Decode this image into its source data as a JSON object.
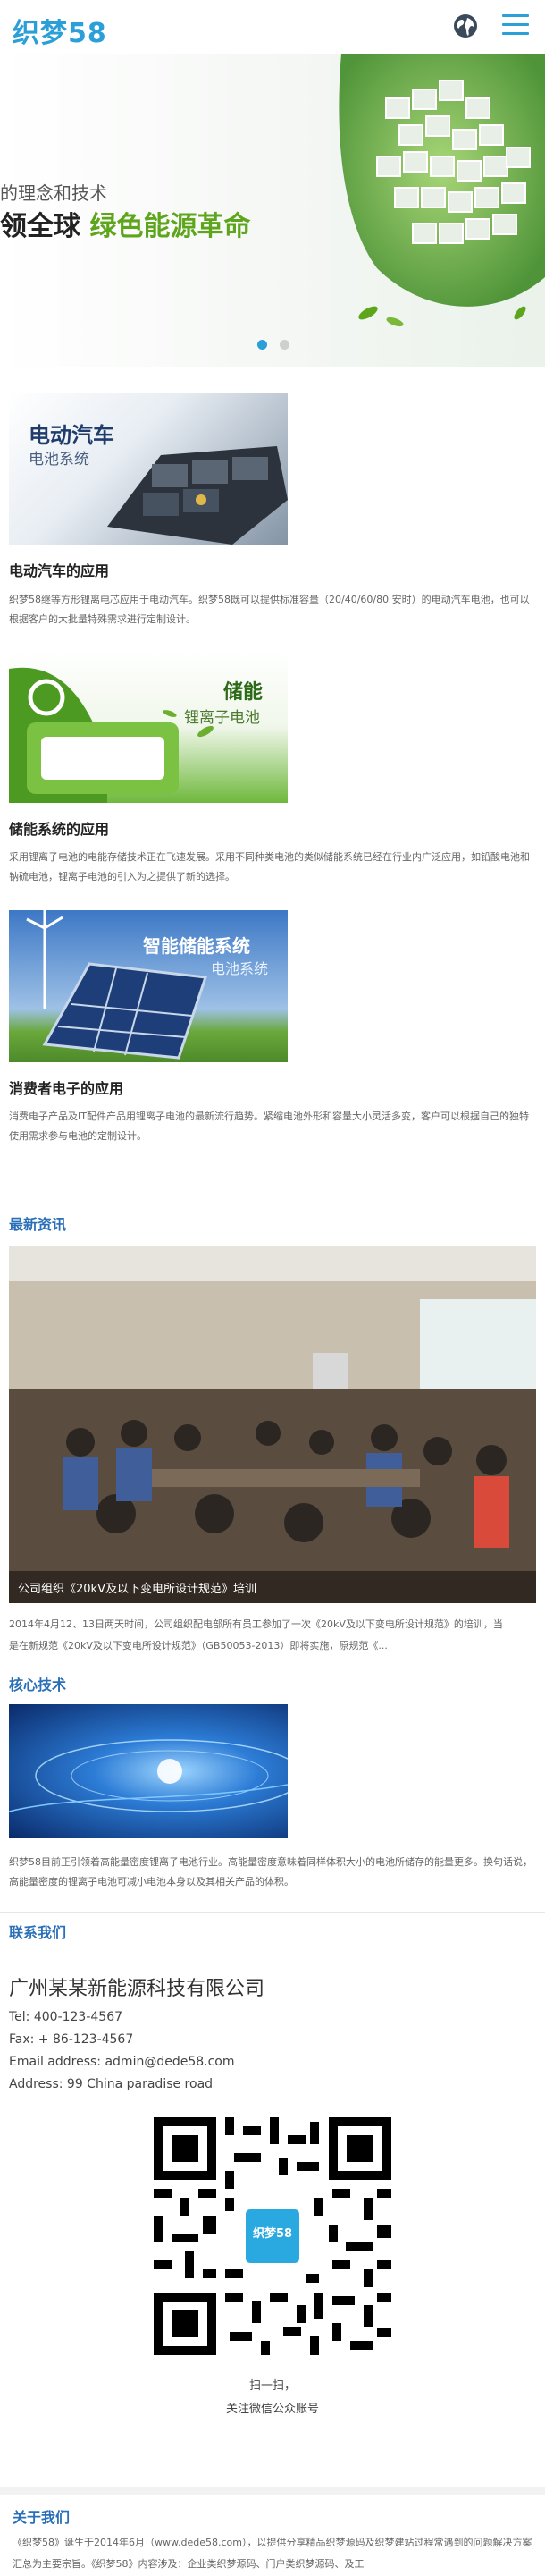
{
  "header": {
    "logo": "织梦58",
    "language_icon": "globe-icon",
    "menu_icon": "hamburger-menu-icon"
  },
  "hero": {
    "line1": "的理念和技术",
    "line2_prefix": "领全球",
    "line2_highlight": "绿色能源革命",
    "slides_total": 2,
    "active_slide": 1
  },
  "products": [
    {
      "image_title": "电动汽车",
      "image_subtitle": "电池系统",
      "title": "电动汽车的应用",
      "desc": "织梦58继等方形锂离电芯应用于电动汽车。织梦58既可以提供标准容量（20/40/60/80 安时）的电动汽车电池，也可以根据客户的大批量特殊需求进行定制设计。"
    },
    {
      "image_title": "储能",
      "image_subtitle": "锂离子电池",
      "title": "储能系统的应用",
      "desc": "采用锂离子电池的电能存储技术正在飞速发展。采用不同种类电池的类似储能系统已经在行业内广泛应用，如铅酸电池和钠硫电池，锂离子电池的引入为之提供了新的选择。"
    },
    {
      "image_title": "智能储能系统",
      "image_subtitle": "电池系统",
      "title": "消费者电子的应用",
      "desc": "消费电子产品及IT配件产品用锂离子电池的最新流行趋势。紧缩电池外形和容量大小灵活多变，客户可以根据自己的独特使用需求参与电池的定制设计。"
    }
  ],
  "news": {
    "section_title": "最新资讯",
    "caption": "公司组织《20kV及以下变电所设计规范》培训",
    "summary_line1": "2014年4月12、13日两天时间，公司组织配电部所有员工参加了一次《20kV及以下变电所设计规范》的培训，当",
    "summary_line2": "是在新规范《20kV及以下变电所设计规范》（GB50053-2013）即将实施，原规范《...",
    "slides_total": 4,
    "active_slide": 4
  },
  "tech": {
    "section_title": "核心技术",
    "desc": "织梦58目前正引领着高能量密度锂离子电池行业。高能量密度意味着同样体积大小的电池所储存的能量更多。换句话说，高能量密度的锂离子电池可减小电池本身以及其相关产品的体积。"
  },
  "contact": {
    "section_title": "联系我们",
    "company": "广州某某新能源科技有限公司",
    "tel": "Tel: 400-123-4567",
    "fax": "Fax: + 86-123-4567",
    "email": "Email address: admin@dede58.com",
    "address": "Address: 99 China paradise road",
    "qr_logo": "织梦58",
    "qr_caption1": "扫一扫，",
    "qr_caption2": "关注微信公众账号"
  },
  "footer": {
    "title": "关于我们",
    "text": "《织梦58》诞生于2014年6月（www.dede58.com），以提供分享精品织梦源码及织梦建站过程常遇到的问题解决方案汇总为主要宗旨。《织梦58》内容涉及：企业类织梦源码、门户类织梦源码、及工"
  },
  "colors": {
    "brand_blue": "#2a9fd8",
    "section_blue": "#2a6fb8",
    "hero_green": "#5da61c"
  }
}
